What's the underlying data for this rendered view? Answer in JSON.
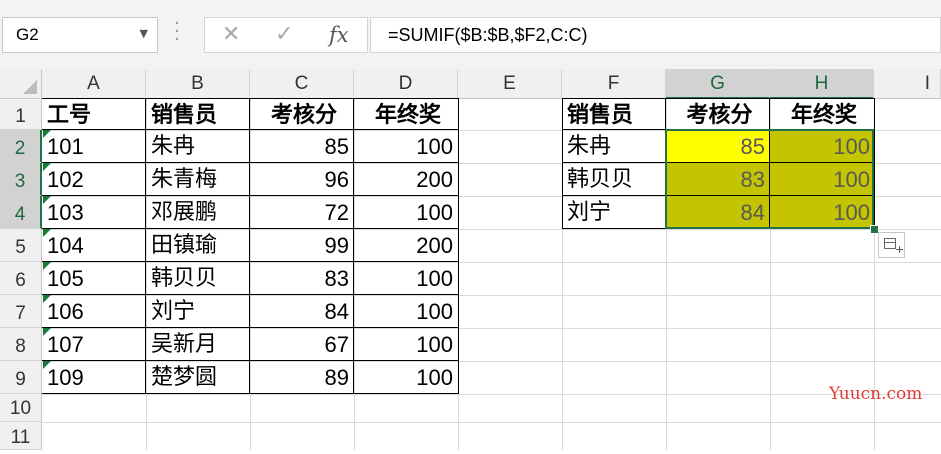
{
  "name_box": "G2",
  "formula": "=SUMIF($B:$B,$F2,C:C)",
  "formula_buttons": {
    "cancel": "✕",
    "enter": "✓",
    "fx": "fx"
  },
  "columns": [
    "A",
    "B",
    "C",
    "D",
    "E",
    "F",
    "G",
    "H",
    "I"
  ],
  "rows": [
    "1",
    "2",
    "3",
    "4",
    "5",
    "6",
    "7",
    "8",
    "9",
    "10",
    "11"
  ],
  "main_table": {
    "headers": [
      "工号",
      "销售员",
      "考核分",
      "年终奖"
    ],
    "rows": [
      [
        "101",
        "朱冉",
        "85",
        "100"
      ],
      [
        "102",
        "朱青梅",
        "96",
        "200"
      ],
      [
        "103",
        "邓展鹏",
        "72",
        "100"
      ],
      [
        "104",
        "田镇瑜",
        "99",
        "200"
      ],
      [
        "105",
        "韩贝贝",
        "83",
        "100"
      ],
      [
        "106",
        "刘宁",
        "84",
        "100"
      ],
      [
        "107",
        "吴新月",
        "67",
        "100"
      ],
      [
        "109",
        "楚梦圆",
        "89",
        "100"
      ]
    ]
  },
  "lookup_table": {
    "headers": [
      "销售员",
      "考核分",
      "年终奖"
    ],
    "rows": [
      [
        "朱冉",
        "85",
        "100"
      ],
      [
        "韩贝贝",
        "83",
        "100"
      ],
      [
        "刘宁",
        "84",
        "100"
      ]
    ]
  },
  "colors": {
    "active_fill": "#ffff00",
    "range_fill": "#c4c400",
    "selection_border": "#217346"
  },
  "watermark": "Yuucn.com"
}
